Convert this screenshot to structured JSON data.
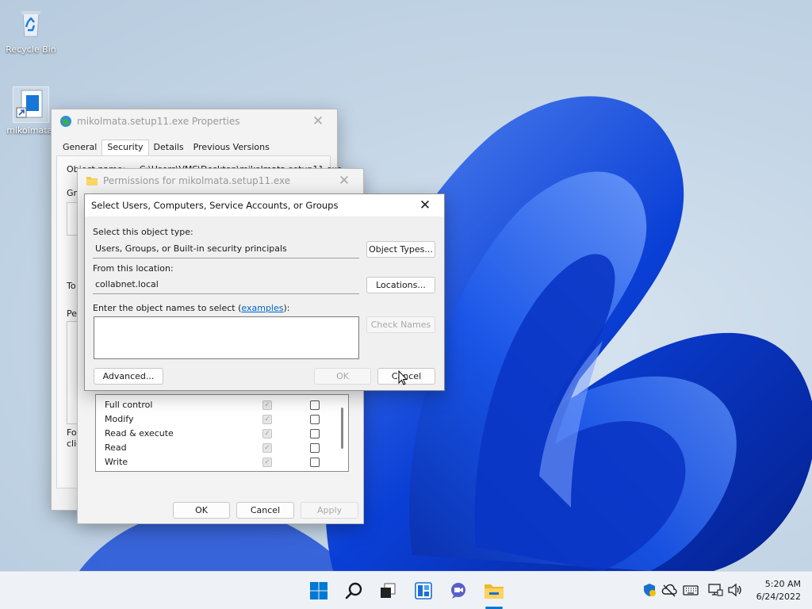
{
  "desktop": {
    "icons": [
      {
        "label": "Recycle Bin",
        "icon": "recycle-bin-icon"
      },
      {
        "label": "mikolmata.",
        "icon": "shortcut-file-icon"
      }
    ]
  },
  "properties_window": {
    "title": "mikolmata.setup11.exe Properties",
    "tabs": [
      "General",
      "Security",
      "Details",
      "Previous Versions"
    ],
    "active_tab": "Security",
    "object_name_label": "Object name:",
    "object_name_value": "C:\\Users\\VMS\\Desktop\\mikolmata.setup11.exe",
    "partial_labels": [
      "Gr",
      "To",
      "Pe",
      "For",
      "clic"
    ]
  },
  "permissions_window": {
    "title": "Permissions for mikolmata.setup11.exe",
    "permissions": [
      {
        "name": "Full control",
        "allow": true,
        "deny": false
      },
      {
        "name": "Modify",
        "allow": true,
        "deny": false
      },
      {
        "name": "Read & execute",
        "allow": true,
        "deny": false
      },
      {
        "name": "Read",
        "allow": true,
        "deny": false
      },
      {
        "name": "Write",
        "allow": true,
        "deny": false
      }
    ],
    "ok_label": "OK",
    "cancel_label": "Cancel",
    "apply_label": "Apply"
  },
  "select_dialog": {
    "title": "Select Users, Computers, Service Accounts, or Groups",
    "object_type_label": "Select this object type:",
    "object_type_value": "Users, Groups, or Built-in security principals",
    "object_types_button": "Object Types...",
    "location_label": "From this location:",
    "location_value": "collabnet.local",
    "locations_button": "Locations...",
    "names_label_prefix": "Enter the object names to select (",
    "names_link": "examples",
    "names_label_suffix": "):",
    "names_value": "",
    "check_names_button": "Check Names",
    "advanced_button": "Advanced...",
    "ok_button": "OK",
    "cancel_button": "Cancel"
  },
  "taskbar": {
    "items": [
      "start-icon",
      "search-icon",
      "task-view-icon",
      "widgets-icon",
      "chat-icon",
      "file-explorer-icon"
    ],
    "tray": [
      "security-shield-icon",
      "onedrive-icon",
      "keyboard-icon",
      "network-icon",
      "volume-icon"
    ],
    "time": "5:20 AM",
    "date": "6/24/2022"
  },
  "colors": {
    "accent": "#0067c0",
    "wallpaper_blue": "#0a3fd6",
    "taskbar": "#eef1f5",
    "link": "#0066cc"
  }
}
